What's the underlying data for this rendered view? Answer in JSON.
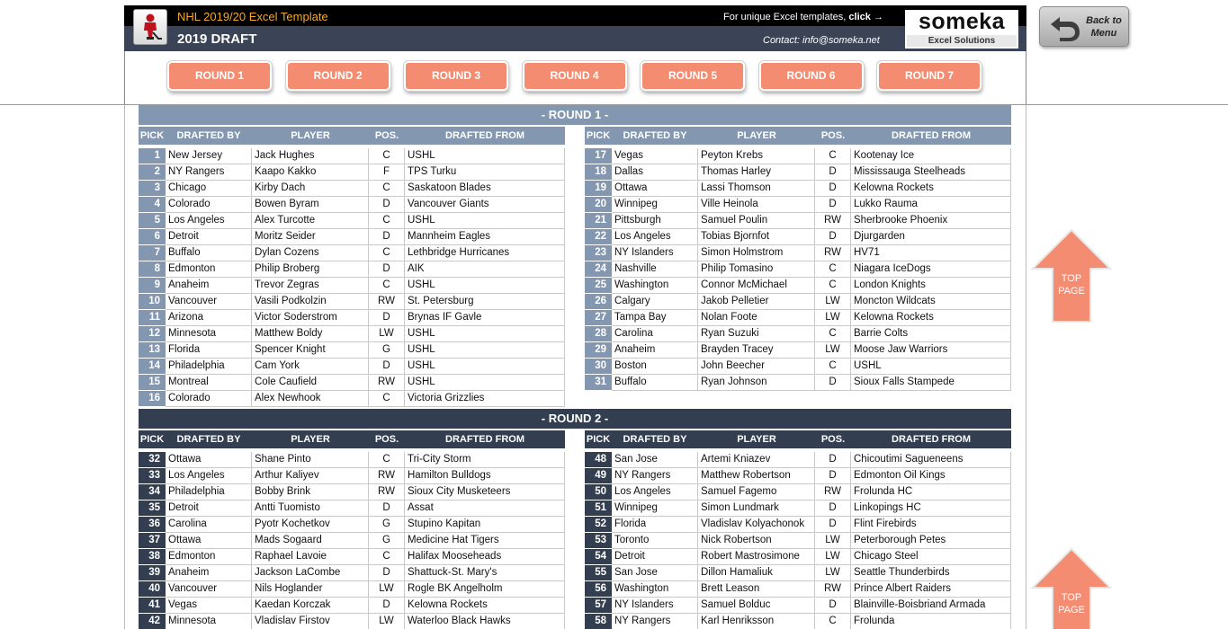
{
  "header": {
    "app_title": "NHL 2019/20 Excel Template",
    "draft_title": "2019 DRAFT",
    "promo_text": "For unique Excel templates,",
    "promo_link": "click →",
    "contact": "Contact: info@someka.net",
    "brand_name": "someka",
    "brand_sub": "Excel Solutions",
    "logo_icon": "hockey-player-icon"
  },
  "back_button": {
    "label_line1": "Back to",
    "label_line2": "Menu",
    "icon": "u-turn-arrow-icon"
  },
  "round_tabs": [
    "ROUND 1",
    "ROUND 2",
    "ROUND 3",
    "ROUND 4",
    "ROUND 5",
    "ROUND 6",
    "ROUND 7"
  ],
  "columns": [
    "PICK",
    "DRAFTED BY",
    "PLAYER",
    "POS.",
    "DRAFTED FROM"
  ],
  "top_page_button": {
    "line1": "TOP",
    "line2": "PAGE",
    "icon": "up-arrow-icon"
  },
  "colors": {
    "round1": "#8497b0",
    "round2": "#333f50",
    "tab": "#f48c72",
    "header_accent": "#f6a827"
  },
  "rounds": [
    {
      "title": "- ROUND 1 -",
      "left": [
        [
          "1",
          "New Jersey",
          "Jack Hughes",
          "C",
          "USHL"
        ],
        [
          "2",
          "NY Rangers",
          "Kaapo Kakko",
          "F",
          "TPS Turku"
        ],
        [
          "3",
          "Chicago",
          "Kirby Dach",
          "C",
          "Saskatoon Blades"
        ],
        [
          "4",
          "Colorado",
          "Bowen Byram",
          "D",
          "Vancouver Giants"
        ],
        [
          "5",
          "Los Angeles",
          "Alex Turcotte",
          "C",
          "USHL"
        ],
        [
          "6",
          "Detroit",
          "Moritz Seider",
          "D",
          "Mannheim Eagles"
        ],
        [
          "7",
          "Buffalo",
          "Dylan Cozens",
          "C",
          "Lethbridge Hurricanes"
        ],
        [
          "8",
          "Edmonton",
          "Philip Broberg",
          "D",
          "AIK"
        ],
        [
          "9",
          "Anaheim",
          "Trevor Zegras",
          "C",
          "USHL"
        ],
        [
          "10",
          "Vancouver",
          "Vasili Podkolzin",
          "RW",
          "St. Petersburg"
        ],
        [
          "11",
          "Arizona",
          "Victor Soderstrom",
          "D",
          "Brynas IF Gavle"
        ],
        [
          "12",
          "Minnesota",
          "Matthew Boldy",
          "LW",
          "USHL"
        ],
        [
          "13",
          "Florida",
          "Spencer Knight",
          "G",
          "USHL"
        ],
        [
          "14",
          "Philadelphia",
          "Cam York",
          "D",
          "USHL"
        ],
        [
          "15",
          "Montreal",
          "Cole Caufield",
          "RW",
          "USHL"
        ],
        [
          "16",
          "Colorado",
          "Alex Newhook",
          "C",
          "Victoria Grizzlies"
        ]
      ],
      "right": [
        [
          "17",
          "Vegas",
          "Peyton Krebs",
          "C",
          "Kootenay Ice"
        ],
        [
          "18",
          "Dallas",
          "Thomas Harley",
          "D",
          "Mississauga Steelheads"
        ],
        [
          "19",
          "Ottawa",
          "Lassi Thomson",
          "D",
          "Kelowna Rockets"
        ],
        [
          "20",
          "Winnipeg",
          "Ville Heinola",
          "D",
          "Lukko Rauma"
        ],
        [
          "21",
          "Pittsburgh",
          "Samuel Poulin",
          "RW",
          "Sherbrooke Phoenix"
        ],
        [
          "22",
          "Los Angeles",
          "Tobias Bjornfot",
          "D",
          "Djurgarden"
        ],
        [
          "23",
          "NY Islanders",
          "Simon Holmstrom",
          "RW",
          "HV71"
        ],
        [
          "24",
          "Nashville",
          "Philip Tomasino",
          "C",
          "Niagara IceDogs"
        ],
        [
          "25",
          "Washington",
          "Connor McMichael",
          "C",
          "London Knights"
        ],
        [
          "26",
          "Calgary",
          "Jakob Pelletier",
          "LW",
          "Moncton Wildcats"
        ],
        [
          "27",
          "Tampa Bay",
          "Nolan Foote",
          "LW",
          "Kelowna Rockets"
        ],
        [
          "28",
          "Carolina",
          "Ryan Suzuki",
          "C",
          "Barrie Colts"
        ],
        [
          "29",
          "Anaheim",
          "Brayden Tracey",
          "LW",
          "Moose Jaw Warriors"
        ],
        [
          "30",
          "Boston",
          "John Beecher",
          "C",
          "USHL"
        ],
        [
          "31",
          "Buffalo",
          "Ryan Johnson",
          "D",
          "Sioux Falls Stampede"
        ]
      ]
    },
    {
      "title": "- ROUND 2 -",
      "left": [
        [
          "32",
          "Ottawa",
          "Shane Pinto",
          "C",
          "Tri-City Storm"
        ],
        [
          "33",
          "Los Angeles",
          "Arthur Kaliyev",
          "RW",
          "Hamilton Bulldogs"
        ],
        [
          "34",
          "Philadelphia",
          "Bobby Brink",
          "RW",
          "Sioux City Musketeers"
        ],
        [
          "35",
          "Detroit",
          "Antti Tuomisto",
          "D",
          "Assat"
        ],
        [
          "36",
          "Carolina",
          "Pyotr Kochetkov",
          "G",
          "Stupino Kapitan"
        ],
        [
          "37",
          "Ottawa",
          "Mads Sogaard",
          "G",
          "Medicine Hat Tigers"
        ],
        [
          "38",
          "Edmonton",
          "Raphael Lavoie",
          "C",
          "Halifax Mooseheads"
        ],
        [
          "39",
          "Anaheim",
          "Jackson LaCombe",
          "D",
          "Shattuck-St. Mary's"
        ],
        [
          "40",
          "Vancouver",
          "Nils Hoglander",
          "LW",
          "Rogle BK Angelholm"
        ],
        [
          "41",
          "Vegas",
          "Kaedan Korczak",
          "D",
          "Kelowna Rockets"
        ],
        [
          "42",
          "Minnesota",
          "Vladislav Firstov",
          "LW",
          "Waterloo Black Hawks"
        ]
      ],
      "right": [
        [
          "48",
          "San Jose",
          "Artemi Kniazev",
          "D",
          "Chicoutimi Sagueneens"
        ],
        [
          "49",
          "NY Rangers",
          "Matthew Robertson",
          "D",
          "Edmonton Oil Kings"
        ],
        [
          "50",
          "Los Angeles",
          "Samuel Fagemo",
          "RW",
          "Frolunda HC"
        ],
        [
          "51",
          "Winnipeg",
          "Simon Lundmark",
          "D",
          "Linkopings HC"
        ],
        [
          "52",
          "Florida",
          "Vladislav Kolyachonok",
          "D",
          "Flint Firebirds"
        ],
        [
          "53",
          "Toronto",
          "Nick Robertson",
          "LW",
          "Peterborough Petes"
        ],
        [
          "54",
          "Detroit",
          "Robert Mastrosimone",
          "LW",
          "Chicago Steel"
        ],
        [
          "55",
          "San Jose",
          "Dillon Hamaliuk",
          "LW",
          "Seattle Thunderbirds"
        ],
        [
          "56",
          "Washington",
          "Brett Leason",
          "RW",
          "Prince Albert Raiders"
        ],
        [
          "57",
          "NY Islanders",
          "Samuel Bolduc",
          "D",
          "Blainville-Boisbriand Armada"
        ],
        [
          "58",
          "NY Rangers",
          "Karl Henriksson",
          "C",
          "Frolunda"
        ]
      ]
    }
  ]
}
